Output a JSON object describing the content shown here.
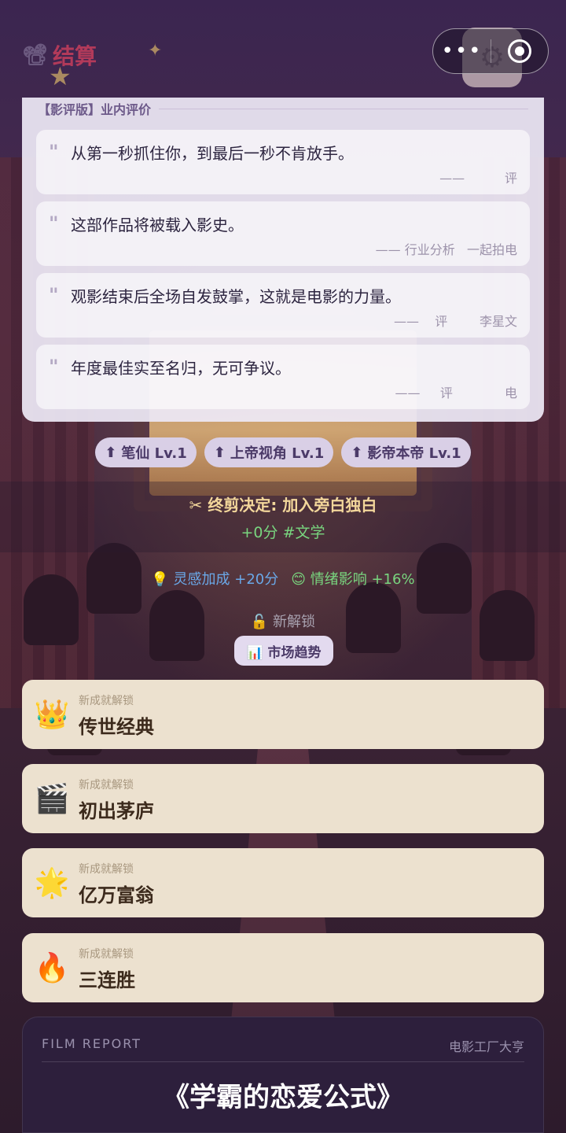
{
  "header": {
    "title": "结算",
    "camera_icon": "film-camera-icon",
    "settings_icon": "gear-icon"
  },
  "capsule": {
    "more_label": "•••",
    "close_icon": "target-close-icon"
  },
  "reviews": {
    "header": "【影评版】业内评价",
    "items": [
      {
        "text": "从第一秒抓住你，到最后一秒不肯放手。",
        "source": "——          评"
      },
      {
        "text": "这部作品将被载入影史。",
        "source": "—— 行业分析   一起拍电"
      },
      {
        "text": "观影结束后全场自发鼓掌，这就是电影的力量。",
        "source": "——    评        李星文"
      },
      {
        "text": "年度最佳实至名归，无可争议。",
        "source": "——     评             电"
      }
    ]
  },
  "skills": [
    {
      "label": "笔仙 Lv.1"
    },
    {
      "label": "上帝视角 Lv.1"
    },
    {
      "label": "影帝本帝 Lv.1"
    }
  ],
  "final_cut": {
    "title": "✂ 终剪决定: 加入旁白独白",
    "score": "+0分 #文学"
  },
  "bonus": {
    "inspiration": "💡 灵感加成 +20分",
    "emotion": "😊 情绪影响 +16%"
  },
  "unlock": {
    "label": "🔓 新解锁",
    "market_button": "📊 市场趋势"
  },
  "achievements": [
    {
      "label": "新成就解锁",
      "name": "传世经典",
      "icon": "👑"
    },
    {
      "label": "新成就解锁",
      "name": "初出茅庐",
      "icon": "🎬"
    },
    {
      "label": "新成就解锁",
      "name": "亿万富翁",
      "icon": "🌟"
    },
    {
      "label": "新成就解锁",
      "name": "三连胜",
      "icon": "🔥"
    }
  ],
  "report": {
    "label": "FILM REPORT",
    "company": "电影工厂大亨",
    "title": "《学霸的恋爱公式》"
  },
  "colors": {
    "accent_title": "#b23a5a",
    "final_title": "#f3d79b",
    "score_green": "#79d67f",
    "inspiration_blue": "#6aa8e8",
    "achievement_bg": "#ece1cf"
  }
}
